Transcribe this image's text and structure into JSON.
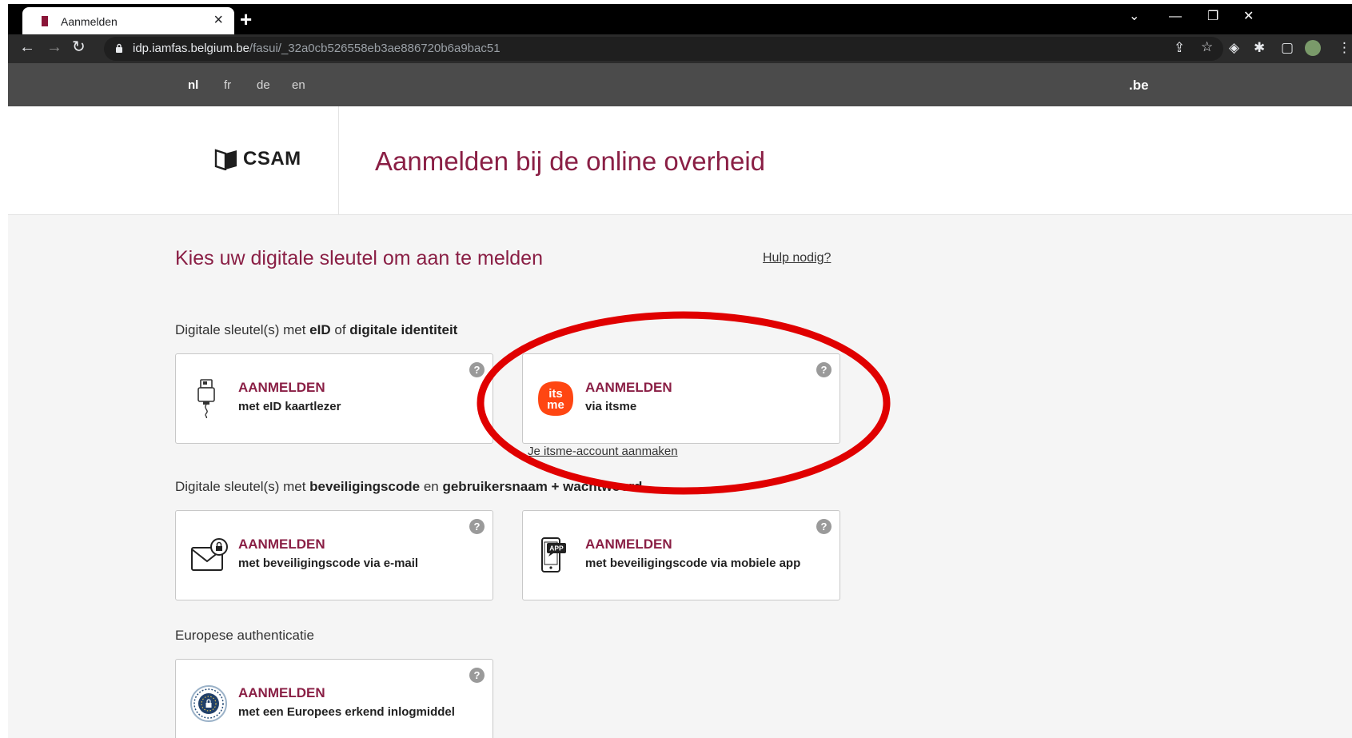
{
  "browser": {
    "tab_title": "Aanmelden",
    "url_domain": "idp.iamfas.belgium.be",
    "url_path": "/fasui/_32a0cb526558eb3ae886720b6a9bac51",
    "icons": [
      "back-icon",
      "forward-icon",
      "reload-icon",
      "lock-icon",
      "share-icon",
      "star-icon",
      "extension-icon",
      "puzzle-icon",
      "sidepanel-icon",
      "profile-avatar",
      "menu-icon"
    ]
  },
  "site": {
    "languages": [
      "nl",
      "fr",
      "de",
      "en"
    ],
    "active_language": "nl",
    "be_logo": ".be",
    "csam_logo": "CSAM",
    "main_title": "Aanmelden bij de online overheid",
    "page_title": "Kies uw digitale sleutel om aan te melden",
    "help_link": "Hulp nodig?"
  },
  "sections": {
    "eid": {
      "label_prefix": "Digitale sleutel(s) met ",
      "b1": "eID",
      "mid": " of ",
      "b2": "digitale identiteit"
    },
    "code": {
      "label_prefix": "Digitale sleutel(s) met ",
      "b1": "beveiligingscode",
      "mid": " en ",
      "b2": "gebruikersnaam + wachtwoord"
    },
    "euro": {
      "label": "Europese authenticatie"
    }
  },
  "cards": {
    "eid_reader": {
      "title": "AANMELDEN",
      "subtitle": "met eID kaartlezer",
      "help": "?"
    },
    "itsme": {
      "title": "AANMELDEN",
      "subtitle": "via itsme",
      "help": "?",
      "logo_text_1": "its",
      "logo_text_2": "me"
    },
    "email_code": {
      "title": "AANMELDEN",
      "subtitle": "met beveiligingscode via e-mail",
      "help": "?"
    },
    "app_code": {
      "title": "AANMELDEN",
      "subtitle": "met beveiligingscode via mobiele app",
      "help": "?",
      "app_badge": "APP"
    },
    "european": {
      "title": "AANMELDEN",
      "subtitle": "met een Europees erkend inlogmiddel",
      "help": "?"
    }
  },
  "itsme_link": "Je itsme-account aanmaken",
  "colors": {
    "accent": "#8a1f45",
    "itsme": "#ff4612",
    "annotation": "#e00000"
  }
}
